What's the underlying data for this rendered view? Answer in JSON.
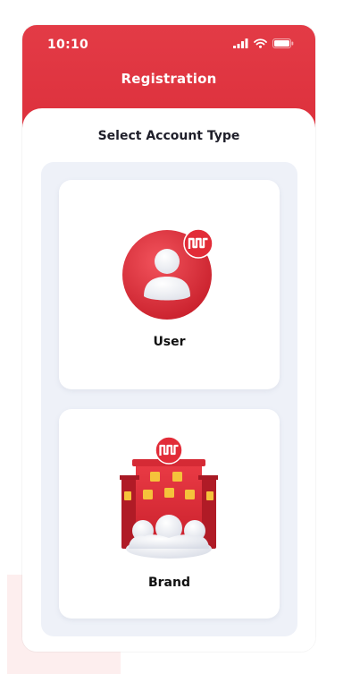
{
  "status": {
    "time": "10:10"
  },
  "header": {
    "title": "Registration"
  },
  "main": {
    "subtitle": "Select Account Type",
    "options": [
      {
        "label": "User"
      },
      {
        "label": "Brand"
      }
    ]
  },
  "colors": {
    "brand_red": "#dc2f3b",
    "panel_bg": "#eef1f8"
  },
  "icons": [
    "cellular-signal-icon",
    "wifi-icon",
    "battery-icon",
    "user-avatar-icon",
    "brand-building-icon",
    "brand-logo-badge-icon"
  ]
}
